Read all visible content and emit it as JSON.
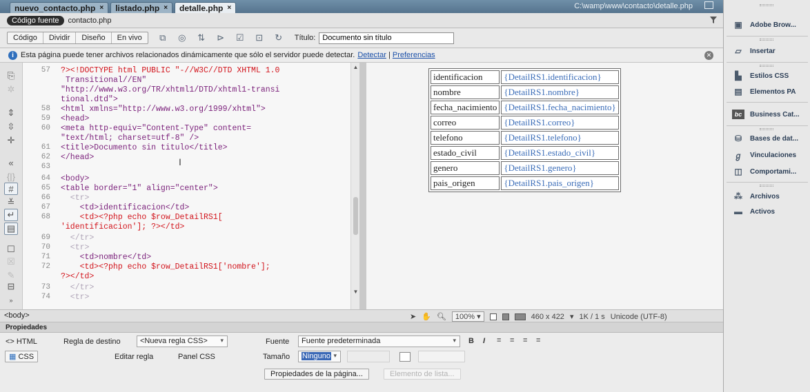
{
  "tabs": [
    {
      "label": "nuevo_contacto.php",
      "close": "×"
    },
    {
      "label": "listado.php",
      "close": "×"
    },
    {
      "label": "detalle.php",
      "close": "×"
    }
  ],
  "file_path": "C:\\wamp\\www\\contacto\\detalle.php",
  "source_bar": {
    "pill": "Código fuente",
    "file": "contacto.php"
  },
  "toolbar": {
    "view_buttons": [
      "Código",
      "Dividir",
      "Diseño",
      "En vivo"
    ],
    "title_label": "Título:",
    "title_value": "Documento sin título"
  },
  "infobar": {
    "message": "Esta página puede tener archivos relacionados dinámicamente que sólo el servidor puede detectar.",
    "detect_link": "Detectar",
    "separator": " | ",
    "prefs_link": "Preferencias"
  },
  "code_lines": [
    {
      "n": "57",
      "t": "?><!DOCTYPE html PUBLIC \"-//W3C//DTD XHTML 1.0"
    },
    {
      "n": "",
      "t": "Transitional//EN\""
    },
    {
      "n": "",
      "t": "\"http://www.w3.org/TR/xhtml1/DTD/xhtml1-transi"
    },
    {
      "n": "",
      "t": "tional.dtd\">"
    },
    {
      "n": "58",
      "t": "<html xmlns=\"http://www.w3.org/1999/xhtml\">"
    },
    {
      "n": "59",
      "t": "<head>"
    },
    {
      "n": "60",
      "t": "<meta http-equiv=\"Content-Type\" content="
    },
    {
      "n": "",
      "t": "\"text/html; charset=utf-8\" />"
    },
    {
      "n": "61",
      "t": "<title>Documento sin titulo</title>"
    },
    {
      "n": "62",
      "t": "</head>"
    },
    {
      "n": "63",
      "t": ""
    },
    {
      "n": "64",
      "t": "<body>"
    },
    {
      "n": "65",
      "t": "<table border=\"1\" align=\"center\">"
    },
    {
      "n": "66",
      "t": "  <tr>"
    },
    {
      "n": "67",
      "t": "    <td>identificacion</td>"
    },
    {
      "n": "68",
      "t": "    <td><?php echo $row_DetailRS1["
    },
    {
      "n": "",
      "t": "'identificacion']; ?></td>"
    },
    {
      "n": "69",
      "t": "  </tr>"
    },
    {
      "n": "70",
      "t": "  <tr>"
    },
    {
      "n": "71",
      "t": "    <td>nombre</td>"
    },
    {
      "n": "72",
      "t": "    <td><?php echo $row_DetailRS1['nombre'];"
    },
    {
      "n": "",
      "t": "?></td>"
    },
    {
      "n": "73",
      "t": "  </tr>"
    },
    {
      "n": "74",
      "t": "  <tr>"
    }
  ],
  "detail_rows": [
    {
      "field": "identificacion",
      "value": "{DetailRS1.identificacion}"
    },
    {
      "field": "nombre",
      "value": "{DetailRS1.nombre}"
    },
    {
      "field": "fecha_nacimiento",
      "value": "{DetailRS1.fecha_nacimiento}"
    },
    {
      "field": "correo",
      "value": "{DetailRS1.correo}"
    },
    {
      "field": "telefono",
      "value": "{DetailRS1.telefono}"
    },
    {
      "field": "estado_civil",
      "value": "{DetailRS1.estado_civil}"
    },
    {
      "field": "genero",
      "value": "{DetailRS1.genero}"
    },
    {
      "field": "pais_origen",
      "value": "{DetailRS1.pais_origen}"
    }
  ],
  "statusbar": {
    "tag": "<body>",
    "zoom": "100%",
    "dimensions": "460 x 422",
    "download": "1K / 1 s",
    "encoding": "Unicode (UTF-8)"
  },
  "properties": {
    "header": "Propiedades",
    "html_tab": "HTML",
    "css_tab": "CSS",
    "rule_label": "Regla de destino",
    "rule_value": "<Nueva regla CSS>",
    "edit_rule": "Editar regla",
    "css_panel": "Panel CSS",
    "font_label": "Fuente",
    "font_value": "Fuente predeterminada",
    "size_label": "Tamaño",
    "size_value": "Ninguno",
    "page_props": "Propiedades de la página...",
    "list_item": "Elemento de lista..."
  },
  "right_panel": [
    {
      "label": "Adobe Brow...",
      "icon": "browser-icon"
    },
    {
      "label": "Insertar",
      "icon": "insert-icon"
    },
    {
      "label": "Estilos CSS",
      "icon": "css-styles-icon"
    },
    {
      "label": "Elementos PA",
      "icon": "ap-elements-icon"
    },
    {
      "label": "Business Cat...",
      "icon": "business-catalyst-icon"
    },
    {
      "label": "Bases de dat...",
      "icon": "database-icon"
    },
    {
      "label": "Vinculaciones",
      "icon": "bindings-icon"
    },
    {
      "label": "Comportami...",
      "icon": "behaviors-icon"
    },
    {
      "label": "Archivos",
      "icon": "files-icon"
    },
    {
      "label": "Activos",
      "icon": "assets-icon"
    }
  ],
  "colors": {
    "accent": "#3b6db8",
    "php": "#d2141c",
    "tag": "#7a1f7a",
    "string": "#1b3faa"
  }
}
